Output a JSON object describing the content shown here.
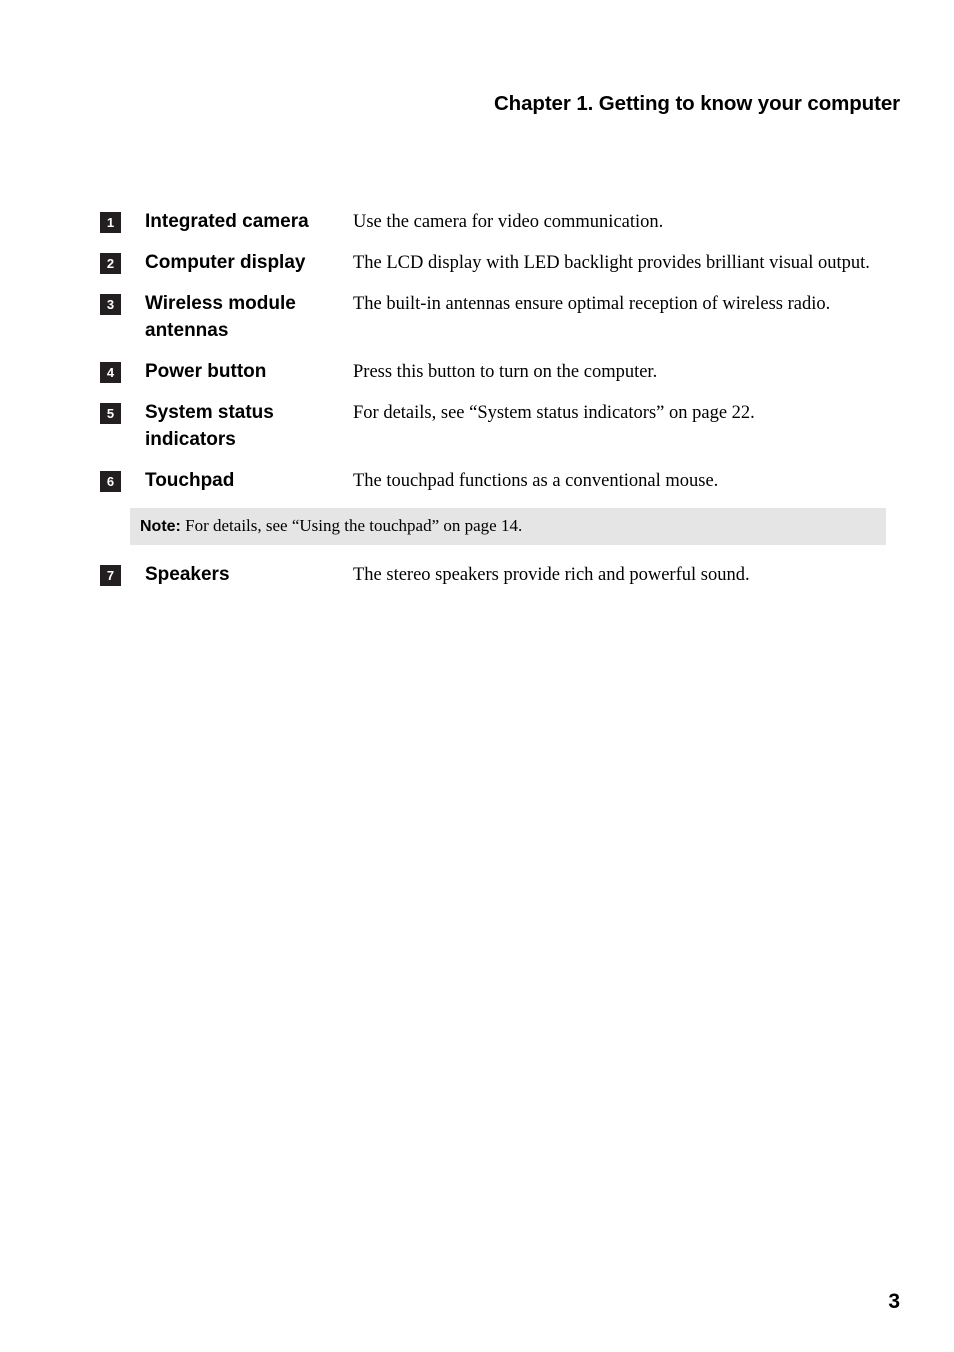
{
  "header": {
    "chapter_title": "Chapter 1. Getting to know your computer"
  },
  "features": [
    {
      "number": "1",
      "label": "Integrated camera",
      "description": "Use the camera for video communication."
    },
    {
      "number": "2",
      "label": "Computer display",
      "description": "The LCD display with LED backlight provides brilliant visual output."
    },
    {
      "number": "3",
      "label": "Wireless module antennas",
      "description": "The built-in antennas ensure optimal reception of wireless radio."
    },
    {
      "number": "4",
      "label": "Power button",
      "description": "Press this button to turn on the computer."
    },
    {
      "number": "5",
      "label": "System status indicators",
      "description": "For details, see “System status indicators” on page 22."
    },
    {
      "number": "6",
      "label": "Touchpad",
      "description": "The touchpad functions as a conventional mouse."
    },
    {
      "number": "7",
      "label": "Speakers",
      "description": "The stereo speakers provide rich and powerful sound."
    }
  ],
  "note": {
    "label": "Note:",
    "text": " For details, see “Using the touchpad” on page 14.",
    "background_color": "#e5e5e5"
  },
  "footer": {
    "page_number": "3"
  },
  "colors": {
    "badge_background": "#231f20",
    "badge_text": "#ffffff",
    "body_text": "#000000",
    "page_background": "#ffffff"
  }
}
